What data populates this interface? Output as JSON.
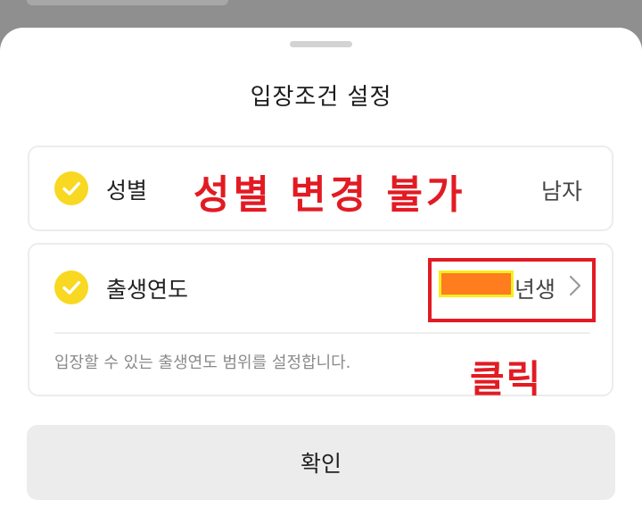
{
  "sheet": {
    "title": "입장조건 설정"
  },
  "gender": {
    "label": "성별",
    "value": "남자",
    "check_icon": "check-circle-icon",
    "annotation": "성별 변경 불가"
  },
  "birth_year": {
    "label": "출생연도",
    "year_suffix": "년생",
    "check_icon": "check-circle-icon",
    "chevron_icon": "chevron-right-icon",
    "helper_text": "입장할 수 있는 출생연도 범위를 설정합니다.",
    "annotation": "클릭"
  },
  "footer": {
    "confirm_label": "확인"
  },
  "colors": {
    "check": "#f8d821",
    "annotation_red": "#e21b23",
    "redaction_fill": "#ff7c1f",
    "redaction_border": "#f6ee1f"
  }
}
